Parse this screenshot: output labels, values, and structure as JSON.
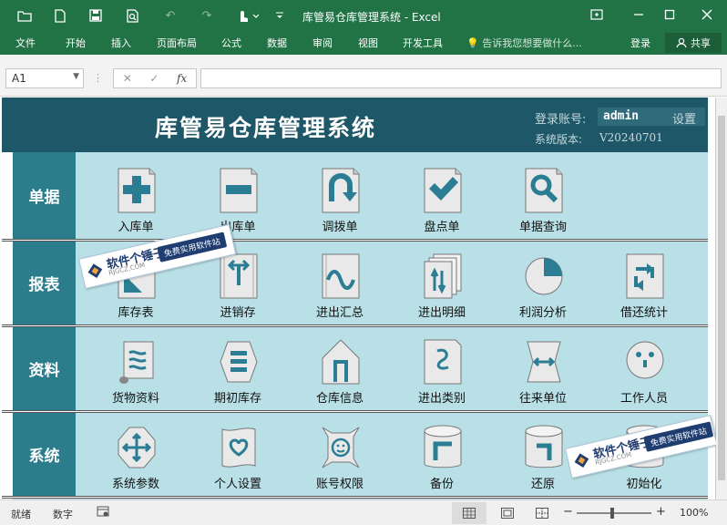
{
  "window": {
    "title": "库管易仓库管理系统 - Excel"
  },
  "ribbon": {
    "tabs": [
      "文件",
      "开始",
      "插入",
      "页面布局",
      "公式",
      "数据",
      "审阅",
      "视图",
      "开发工具"
    ],
    "tell_me": "告诉我您想要做什么...",
    "login": "登录",
    "share": "共享"
  },
  "formula_bar": {
    "name_box": "A1",
    "fx": "fx"
  },
  "app": {
    "title": "库管易仓库管理系统",
    "account_label": "登录账号:",
    "account_value": "admin",
    "settings": "设置",
    "version_label": "系统版本:",
    "version_value": "V20240701",
    "categories": [
      {
        "label": "单据",
        "items": [
          {
            "label": "入库单",
            "icon": "plus-icon"
          },
          {
            "label": "出库单",
            "icon": "minus-icon"
          },
          {
            "label": "调拨单",
            "icon": "u-turn-icon"
          },
          {
            "label": "盘点单",
            "icon": "check-icon"
          },
          {
            "label": "单据查询",
            "icon": "search-icon"
          }
        ]
      },
      {
        "label": "报表",
        "items": [
          {
            "label": "库存表",
            "icon": "stock-table-icon"
          },
          {
            "label": "进销存",
            "icon": "in-out-arrows-icon"
          },
          {
            "label": "进出汇总",
            "icon": "wave-icon"
          },
          {
            "label": "进出明细",
            "icon": "pages-icon"
          },
          {
            "label": "利润分析",
            "icon": "pie-icon"
          },
          {
            "label": "借还统计",
            "icon": "swap-icon"
          }
        ]
      },
      {
        "label": "资料",
        "items": [
          {
            "label": "货物资料",
            "icon": "scroll-icon"
          },
          {
            "label": "期初库存",
            "icon": "list-icon"
          },
          {
            "label": "仓库信息",
            "icon": "house-icon"
          },
          {
            "label": "进出类别",
            "icon": "category-icon"
          },
          {
            "label": "往来单位",
            "icon": "partner-icon"
          },
          {
            "label": "工作人员",
            "icon": "face-icon"
          }
        ]
      },
      {
        "label": "系统",
        "items": [
          {
            "label": "系统参数",
            "icon": "move-icon"
          },
          {
            "label": "个人设置",
            "icon": "heart-icon"
          },
          {
            "label": "账号权限",
            "icon": "smile-lock-icon"
          },
          {
            "label": "备份",
            "icon": "cylinder-backup-icon"
          },
          {
            "label": "还原",
            "icon": "cylinder-restore-icon"
          },
          {
            "label": "初始化",
            "icon": "cylinder-init-icon"
          }
        ]
      }
    ]
  },
  "watermark": {
    "name": "软件个锤子",
    "band": "免费实用软件站",
    "site": "RJGCZ.COM"
  },
  "status": {
    "ready": "就绪",
    "mode": "数字",
    "zoom": "100%"
  }
}
